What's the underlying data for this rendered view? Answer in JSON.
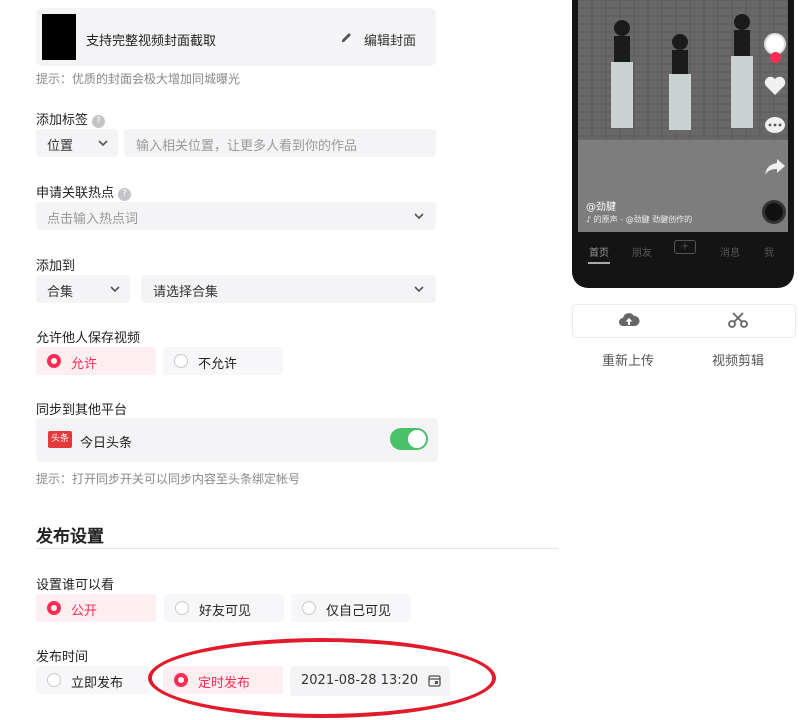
{
  "cover": {
    "title": "支持完整视频封面截取",
    "edit_label": "编辑封面",
    "hint": "提示：优质的封面会极大增加同城曝光"
  },
  "tags": {
    "label": "添加标签",
    "type_value": "位置",
    "input_placeholder": "输入相关位置，让更多人看到你的作品"
  },
  "hotspot": {
    "label": "申请关联热点",
    "placeholder": "点击输入热点词"
  },
  "add_to": {
    "label": "添加到",
    "type_value": "合集",
    "collection_placeholder": "请选择合集"
  },
  "save_video": {
    "label": "允许他人保存视频",
    "options": [
      "允许",
      "不允许"
    ],
    "selected": "允许"
  },
  "sync": {
    "label": "同步到其他平台",
    "platform_logo": "头条",
    "platform_name": "今日头条",
    "enabled": true,
    "hint": "提示：打开同步开关可以同步内容至头条绑定帐号"
  },
  "publish_settings": {
    "heading": "发布设置",
    "visibility": {
      "label": "设置谁可以看",
      "options": [
        "公开",
        "好友可见",
        "仅自己可见"
      ],
      "selected": "公开"
    },
    "time": {
      "label": "发布时间",
      "options": [
        "立即发布",
        "定时发布"
      ],
      "selected": "定时发布",
      "datetime": "2021-08-28 13:20"
    }
  },
  "preview": {
    "author": "@劲腱",
    "music": "♪ 的原声 - @劲腱 劲腱创作的",
    "nav": [
      "首页",
      "朋友",
      "+",
      "消息",
      "我"
    ],
    "active_nav": "首页"
  },
  "tools": {
    "reupload_label": "重新上传",
    "edit_video_label": "视频剪辑"
  },
  "colors": {
    "accent": "#fe2c55",
    "toggle_on": "#49c26a",
    "annotation": "#e11b2b"
  }
}
